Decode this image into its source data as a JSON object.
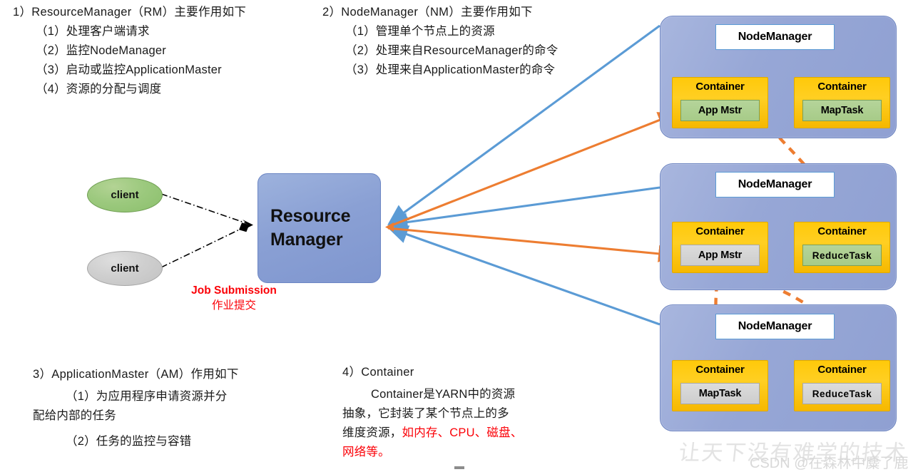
{
  "sections": {
    "rm": {
      "heading": "1）ResourceManager（RM）主要作用如下",
      "items": [
        "（1）处理客户端请求",
        "（2）监控NodeManager",
        "（3）启动或监控ApplicationMaster",
        "（4）资源的分配与调度"
      ]
    },
    "nm": {
      "heading": "2）NodeManager（NM）主要作用如下",
      "items": [
        "（1）管理单个节点上的资源",
        "（2）处理来自ResourceManager的命令",
        "（3）处理来自ApplicationMaster的命令"
      ]
    },
    "am": {
      "heading": "3）ApplicationMaster（AM）作用如下",
      "items": [
        "（1）为应用程序申请资源并分",
        "配给内部的任务",
        "（2）任务的监控与容错"
      ]
    },
    "container": {
      "heading": "4）Container",
      "lines": [
        "Container是YARN中的资源",
        "抽象，它封装了某个节点上的多",
        "维度资源，"
      ],
      "highlight_line_3_tail": "如内存、CPU、磁盘、",
      "highlight_line_4": "网络等。",
      "highlight_color": "#fb0007"
    }
  },
  "diagram": {
    "clients": [
      {
        "label": "client",
        "fill": "#9cc97e"
      },
      {
        "label": "client",
        "fill": "#cfcfcf"
      }
    ],
    "resource_manager": {
      "line1": "Resource",
      "line2": "Manager",
      "fill": "#8aa0d4"
    },
    "job_submission": {
      "en": "Job Submission",
      "cn": "作业提交",
      "color": "#fb0007"
    },
    "arrow_colors": {
      "blue": "#5b9bd5",
      "orange": "#ed7d31",
      "dashdot_black": "#000000"
    },
    "panels": [
      {
        "node_manager": "NodeManager",
        "containers": [
          {
            "title": "Container",
            "task": "App Mstr",
            "task_style": "green"
          },
          {
            "title": "Container",
            "task": "MapTask",
            "task_style": "green"
          }
        ]
      },
      {
        "node_manager": "NodeManager",
        "containers": [
          {
            "title": "Container",
            "task": "App Mstr",
            "task_style": "gray"
          },
          {
            "title": "Container",
            "task": "ReduceTask",
            "task_style": "green"
          }
        ]
      },
      {
        "node_manager": "NodeManager",
        "containers": [
          {
            "title": "Container",
            "task": "MapTask",
            "task_style": "gray"
          },
          {
            "title": "Container",
            "task": "ReduceTask",
            "task_style": "gray"
          }
        ]
      }
    ]
  },
  "watermark": {
    "calligraphy": "让天下没有难学的技术",
    "csdn": "CSDN @在森林中麋了鹿"
  }
}
